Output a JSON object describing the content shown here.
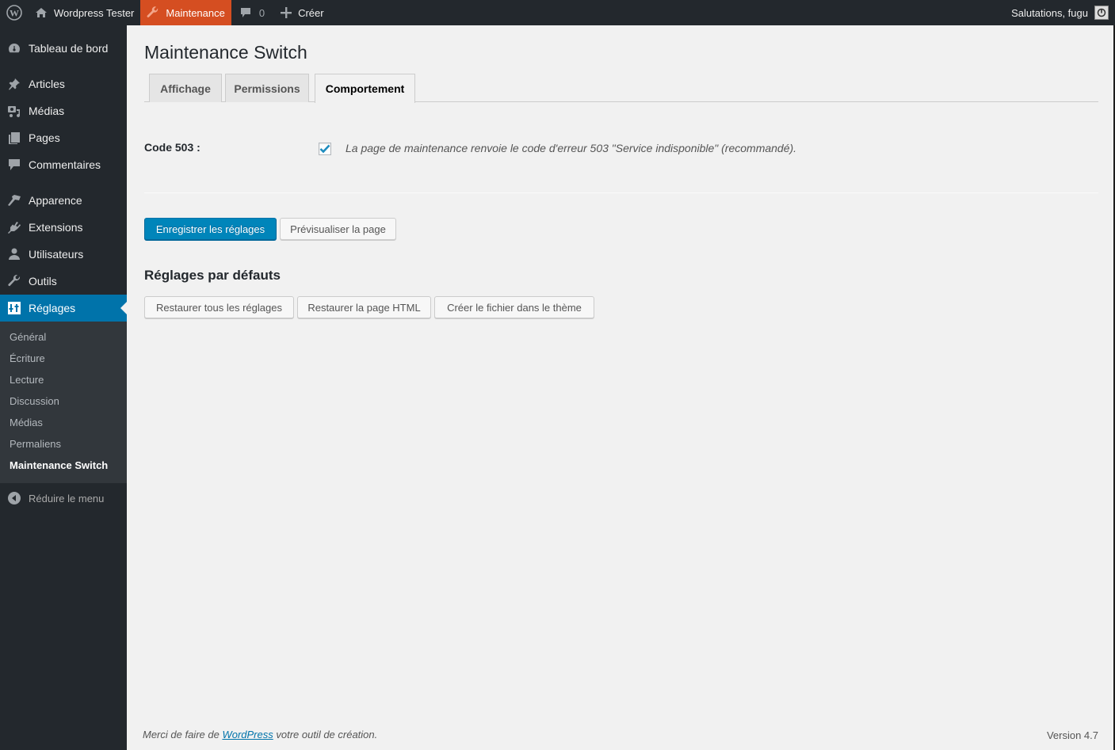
{
  "adminbar": {
    "site_name": "Wordpress Tester",
    "maintenance_label": "Maintenance",
    "comments_count": "0",
    "new_label": "Créer",
    "greeting": "Salutations, fugu",
    "maintenance_color": "#d54e21"
  },
  "sidebar": {
    "items": [
      {
        "label": "Tableau de bord",
        "icon": "dashboard-icon"
      },
      {
        "label": "Articles",
        "icon": "pin-icon"
      },
      {
        "label": "Médias",
        "icon": "media-icon"
      },
      {
        "label": "Pages",
        "icon": "pages-icon"
      },
      {
        "label": "Commentaires",
        "icon": "comment-icon"
      },
      {
        "label": "Apparence",
        "icon": "brush-icon"
      },
      {
        "label": "Extensions",
        "icon": "plugin-icon"
      },
      {
        "label": "Utilisateurs",
        "icon": "user-icon"
      },
      {
        "label": "Outils",
        "icon": "wrench-icon"
      },
      {
        "label": "Réglages",
        "icon": "settings-icon",
        "current": true
      }
    ],
    "submenu": [
      {
        "label": "Général"
      },
      {
        "label": "Écriture"
      },
      {
        "label": "Lecture"
      },
      {
        "label": "Discussion"
      },
      {
        "label": "Médias"
      },
      {
        "label": "Permaliens"
      },
      {
        "label": "Maintenance Switch",
        "current": true
      }
    ],
    "collapse_label": "Réduire le menu",
    "accent_color": "#0073aa"
  },
  "main": {
    "title": "Maintenance Switch",
    "tabs": [
      {
        "label": "Affichage"
      },
      {
        "label": "Permissions"
      },
      {
        "label": "Comportement",
        "active": true
      }
    ],
    "field": {
      "label": "Code 503 :",
      "checked": true,
      "description": "La page de maintenance renvoie le code d'erreur 503 \"Service indisponible\" (recommandé)."
    },
    "save_button": "Enregistrer les réglages",
    "preview_button": "Prévisualiser la page",
    "defaults_title": "Réglages par défauts",
    "defaults_buttons": [
      "Restaurer tous les réglages",
      "Restaurer la page HTML",
      "Créer le fichier dans le thème"
    ]
  },
  "footer": {
    "thanks_prefix": "Merci de faire de ",
    "thanks_link": "WordPress",
    "thanks_suffix": " votre outil de création.",
    "version": "Version 4.7"
  }
}
